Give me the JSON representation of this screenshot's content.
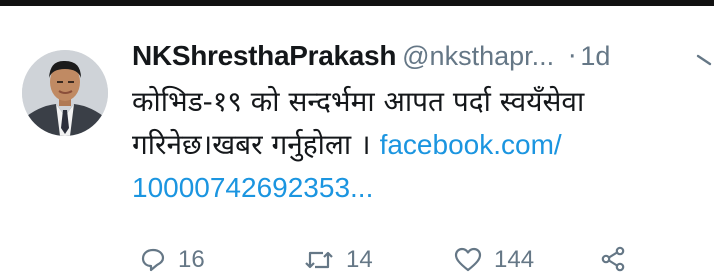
{
  "author": {
    "display_name": "NKShresthaPrakash",
    "handle": "@nksthapr...",
    "separator": "·",
    "time": "1d"
  },
  "tweet": {
    "text_line1": "कोभिड-१९ को सन्दर्भमा आपत पर्दा स्वयँसेवा",
    "text_line2": "गरिनेछ।खबर गर्नुहोला । ",
    "link_part1": "facebook.com/",
    "link_part2": "10000742692353..."
  },
  "actions": {
    "reply_count": "16",
    "retweet_count": "14",
    "like_count": "144"
  },
  "icons": [
    "reply-icon",
    "retweet-icon",
    "like-icon",
    "share-icon",
    "chevron-down-icon"
  ],
  "colors": {
    "text": "#14171a",
    "secondary": "#657786",
    "link": "#1b95e0"
  }
}
